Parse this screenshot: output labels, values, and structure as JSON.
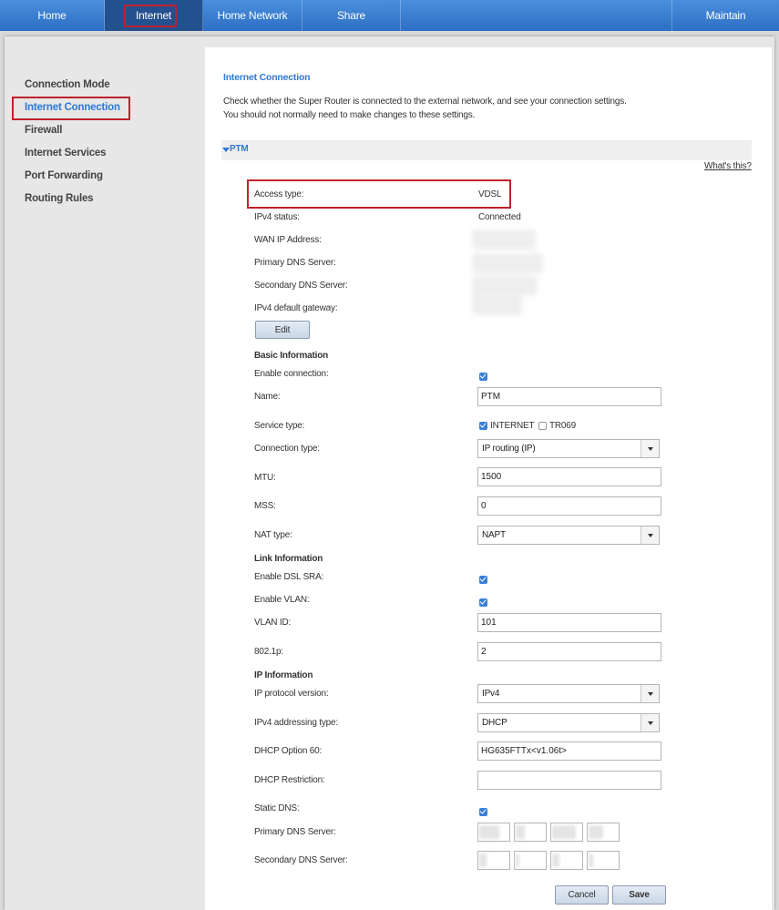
{
  "nav": {
    "tabs": [
      "Home",
      "Internet",
      "Home Network",
      "Share"
    ],
    "maintain": "Maintain"
  },
  "sidebar": {
    "items": [
      "Connection Mode",
      "Internet Connection",
      "Firewall",
      "Internet Services",
      "Port Forwarding",
      "Routing Rules"
    ]
  },
  "main": {
    "title": "Internet Connection",
    "intro1": "Check whether the Super Router is connected to the external network, and see your connection settings.",
    "intro2": "You should not normally need to make changes to these settings.",
    "section": "PTM",
    "whats_this": "What's this?",
    "status": {
      "access_type_label": "Access type:",
      "access_type": "VDSL",
      "ipv4_status_label": "IPv4 status:",
      "ipv4_status": "Connected",
      "wan_ip_label": "WAN IP Address:",
      "primary_dns_label": "Primary DNS Server:",
      "secondary_dns_label": "Secondary DNS Server:",
      "gateway_label": "IPv4 default gateway:",
      "edit": "Edit"
    },
    "basic": {
      "heading": "Basic Information",
      "enable_label": "Enable connection:",
      "name_label": "Name:",
      "name": "PTM",
      "service_label": "Service type:",
      "service_internet": "INTERNET",
      "service_tr069": "TR069",
      "conn_type_label": "Connection type:",
      "conn_type": "IP routing (IP)",
      "mtu_label": "MTU:",
      "mtu": "1500",
      "mss_label": "MSS:",
      "mss": "0",
      "nat_label": "NAT type:",
      "nat": "NAPT"
    },
    "link": {
      "heading": "Link Information",
      "sra_label": "Enable DSL SRA:",
      "vlan_label": "Enable VLAN:",
      "vlan_id_label": "VLAN ID:",
      "vlan_id": "101",
      "p8021_label": "802.1p:",
      "p8021": "2"
    },
    "ip": {
      "heading": "IP Information",
      "proto_label": "IP protocol version:",
      "proto": "IPv4",
      "addr_label": "IPv4 addressing type:",
      "addr": "DHCP",
      "opt60_label": "DHCP Option 60:",
      "opt60": "HG635FTTx<v1.06t>",
      "restrict_label": "DHCP Restriction:",
      "restrict": "",
      "static_dns_label": "Static DNS:",
      "pdns_label": "Primary DNS Server:",
      "sdns_label": "Secondary DNS Server:"
    },
    "buttons": {
      "cancel": "Cancel",
      "save": "Save"
    }
  },
  "checkboxes": {
    "enable_connection": true,
    "service_internet": true,
    "service_tr069": false,
    "dsl_sra": true,
    "vlan": true,
    "static_dns": true
  },
  "colors": {
    "accent": "#2f78d4",
    "nav": "#2d6fc4",
    "highlight": "#c0212c"
  }
}
